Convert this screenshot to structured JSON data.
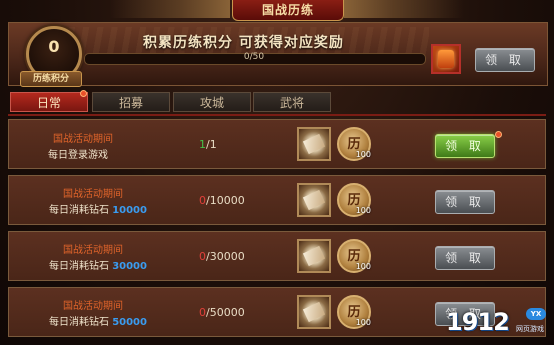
{
  "title": "国战历练",
  "header": {
    "points_value": "0",
    "points_label": "历练积分",
    "headline": "积累历练积分 可获得对应奖励",
    "progress_text": "0/50",
    "progress_fraction": 0.0,
    "claim_label": "领 取"
  },
  "tabs": [
    {
      "label": "日常",
      "active": true,
      "badge": true
    },
    {
      "label": "招募",
      "active": false
    },
    {
      "label": "攻城",
      "active": false
    },
    {
      "label": "武将",
      "active": false
    }
  ],
  "tasks": [
    {
      "title": "国战活动期间",
      "desc_prefix": "每日登录游戏",
      "desc_num": "",
      "current": "1",
      "target": "/1",
      "completed": true,
      "reward_qty": "100",
      "claim_label": "领 取",
      "claim_state": "ready"
    },
    {
      "title": "国战活动期间",
      "desc_prefix": "每日消耗钻石",
      "desc_num": "10000",
      "current": "0",
      "target": "/10000",
      "completed": false,
      "reward_qty": "100",
      "claim_label": "领 取",
      "claim_state": "disabled"
    },
    {
      "title": "国战活动期间",
      "desc_prefix": "每日消耗钻石",
      "desc_num": "30000",
      "current": "0",
      "target": "/30000",
      "completed": false,
      "reward_qty": "100",
      "claim_label": "领 取",
      "claim_state": "disabled"
    },
    {
      "title": "国战活动期间",
      "desc_prefix": "每日消耗钻石",
      "desc_num": "50000",
      "current": "0",
      "target": "/50000",
      "completed": false,
      "reward_qty": "100",
      "claim_label": "领 取",
      "claim_state": "disabled"
    }
  ],
  "coin_char": "历",
  "watermark": {
    "number": "1912",
    "badge": "YX",
    "sub": "网页游戏"
  },
  "colors": {
    "accent_red": "#b42a1e",
    "claim_green": "#6aa830",
    "disabled_gray": "#6a6e72",
    "title_orange": "#e0642a",
    "highlight_blue": "#3a9cf0"
  }
}
